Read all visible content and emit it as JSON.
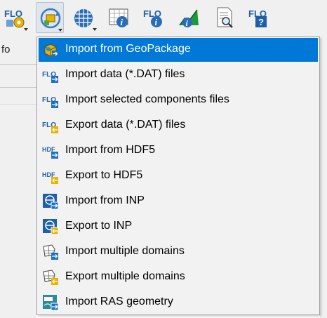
{
  "toolbar": {
    "buttons": [
      {
        "icon": "flo2d-settings-icon",
        "has_dropdown": true
      },
      {
        "icon": "import-export-icon",
        "has_dropdown": true,
        "active": true
      },
      {
        "icon": "flo2d-grid-tools-icon",
        "has_dropdown": true
      },
      {
        "icon": "info-tool-icon",
        "has_dropdown": false
      },
      {
        "icon": "flo2d-info-icon",
        "has_dropdown": false
      },
      {
        "icon": "profile-info-icon",
        "has_dropdown": false
      },
      {
        "icon": "results-icon",
        "has_dropdown": false
      },
      {
        "icon": "flo2d-help-icon",
        "has_dropdown": false
      }
    ]
  },
  "panel": {
    "partial_label": "fo"
  },
  "menu": {
    "items": [
      {
        "label": "Import from GeoPackage",
        "icon": "geopackage-import-icon",
        "highlighted": true
      },
      {
        "label": "Import data (*.DAT) files",
        "icon": "flo-import-icon"
      },
      {
        "label": "Import selected components files",
        "icon": "flo-import-selected-icon"
      },
      {
        "label": "Export data (*.DAT) files",
        "icon": "flo-export-icon"
      },
      {
        "label": "Import from HDF5",
        "icon": "hdf5-import-icon"
      },
      {
        "label": "Export to HDF5",
        "icon": "hdf5-export-icon"
      },
      {
        "label": "Import from INP",
        "icon": "inp-import-icon"
      },
      {
        "label": "Export to INP",
        "icon": "inp-export-icon"
      },
      {
        "label": "Import multiple domains",
        "icon": "multiple-domains-import-icon"
      },
      {
        "label": "Export multiple domains",
        "icon": "multiple-domains-export-icon"
      },
      {
        "label": "Import RAS geometry",
        "icon": "ras-geometry-import-icon"
      }
    ]
  },
  "colors": {
    "highlight": "#0078d7",
    "menu_bg": "#f2f2f2",
    "toolbar_bg": "#f0f0f0"
  }
}
